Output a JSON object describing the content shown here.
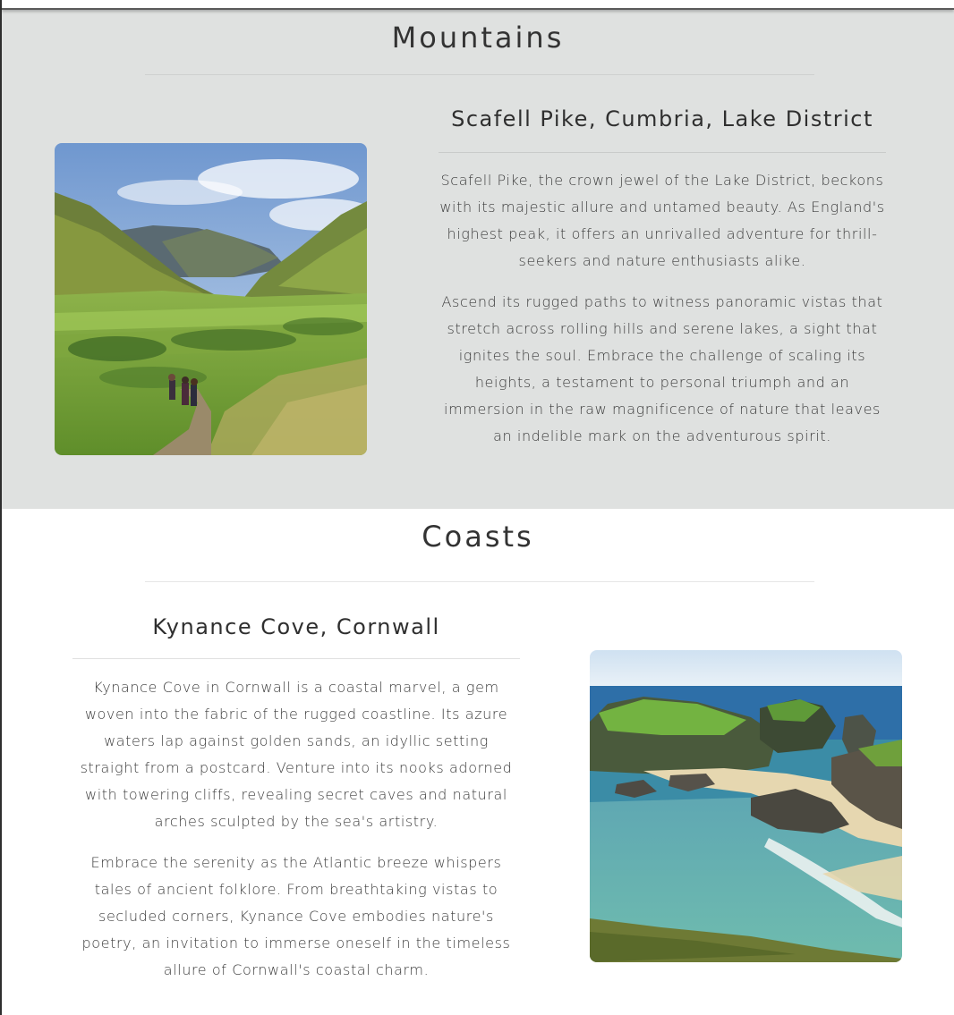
{
  "mountains": {
    "heading": "Mountains",
    "card": {
      "title": "Scafell Pike, Cumbria, Lake District",
      "paragraphs": [
        "Scafell Pike, the crown jewel of the Lake District, beckons with its majestic allure and untamed beauty. As England's highest peak, it offers an unrivalled adventure for thrill-seekers and nature enthusiasts alike.",
        "Ascend its rugged paths to witness panoramic vistas that stretch across rolling hills and serene lakes, a sight that ignites the soul. Embrace the challenge of scaling its heights, a testament to personal triumph and an immersion in the raw magnificence of nature that leaves an indelible mark on the adventurous spirit."
      ]
    }
  },
  "coasts": {
    "heading": "Coasts",
    "card": {
      "title": "Kynance Cove, Cornwall",
      "paragraphs": [
        "Kynance Cove in Cornwall is a coastal marvel, a gem woven into the fabric of the rugged coastline. Its azure waters lap against golden sands, an idyllic setting straight from a postcard. Venture into its nooks adorned with towering cliffs, revealing secret caves and natural arches sculpted by the sea's artistry.",
        "Embrace the serenity as the Atlantic breeze whispers tales of ancient folklore. From breathtaking vistas to secluded corners, Kynance Cove embodies nature's poetry, an invitation to immerse oneself in the timeless allure of Cornwall's coastal charm."
      ]
    }
  },
  "colors": {
    "mountains_bg": "#dfe1e0",
    "coasts_bg": "#ffffff",
    "heading_text": "#333333"
  }
}
